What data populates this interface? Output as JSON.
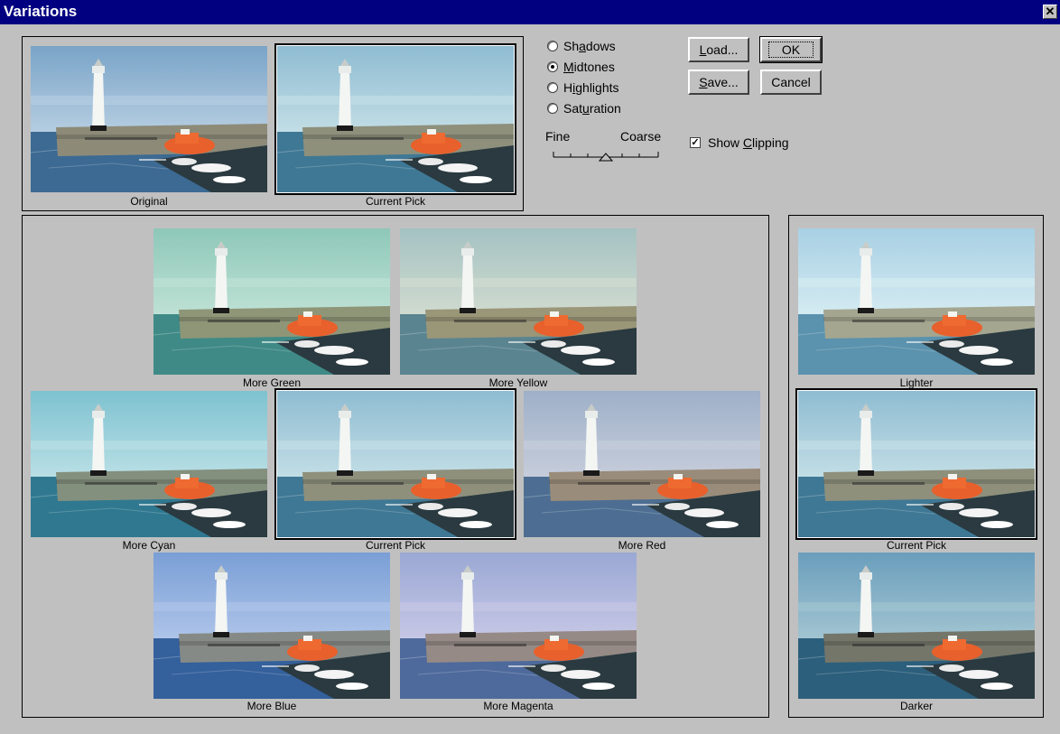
{
  "window": {
    "title": "Variations",
    "close_glyph": "✕"
  },
  "top_panel": {
    "original_caption": "Original",
    "current_pick_caption": "Current Pick"
  },
  "tone_options": [
    {
      "label": "Shadows",
      "checked": false
    },
    {
      "label": "Midtones",
      "checked": true
    },
    {
      "label": "Highlights",
      "checked": false
    },
    {
      "label": "Saturation",
      "checked": false
    }
  ],
  "slider": {
    "fine_label": "Fine",
    "coarse_label": "Coarse",
    "position_fraction": 0.5
  },
  "buttons": {
    "load_label": "Load...",
    "ok_label": "OK",
    "save_label": "Save...",
    "cancel_label": "Cancel"
  },
  "show_clipping": {
    "label": "Show Clipping",
    "checked": true
  },
  "color_variations": {
    "more_green": "More Green",
    "more_yellow": "More Yellow",
    "more_cyan": "More Cyan",
    "current_pick": "Current Pick",
    "more_red": "More Red",
    "more_blue": "More Blue",
    "more_magenta": "More Magenta"
  },
  "brightness_variations": {
    "lighter": "Lighter",
    "current_pick": "Current Pick",
    "darker": "Darker"
  },
  "tints": {
    "original": {
      "sky_top": "#7aa4c8",
      "sky_bottom": "#b8cfe2",
      "sea": "#3c6a93",
      "wall": "#8d8b78"
    },
    "current": {
      "sky_top": "#8fbcd2",
      "sky_bottom": "#c4dfe6",
      "sea": "#3f7895",
      "wall": "#8e907c"
    },
    "green": {
      "sky_top": "#8ec8b8",
      "sky_bottom": "#c0e2d6",
      "sea": "#3f8a86",
      "wall": "#8e9677"
    },
    "yellow": {
      "sky_top": "#a4c2c2",
      "sky_bottom": "#d2dcd0",
      "sea": "#5a8490",
      "wall": "#9a9678"
    },
    "cyan": {
      "sky_top": "#7ec2d0",
      "sky_bottom": "#bce0e6",
      "sea": "#2f7890",
      "wall": "#84907e"
    },
    "red": {
      "sky_top": "#9eb0c8",
      "sky_bottom": "#c8cedc",
      "sea": "#4d6e92",
      "wall": "#9a8c7a"
    },
    "blue": {
      "sky_top": "#7a9ed6",
      "sky_bottom": "#b0c6ea",
      "sea": "#34609c",
      "wall": "#868a86"
    },
    "magenta": {
      "sky_top": "#9aa8d4",
      "sky_bottom": "#c8c8e6",
      "sea": "#4e6a9c",
      "wall": "#958a86"
    },
    "lighter": {
      "sky_top": "#a8d0e4",
      "sky_bottom": "#d6ecf2",
      "sea": "#5b92ad",
      "wall": "#a4a690"
    },
    "darker": {
      "sky_top": "#6a9ebc",
      "sky_bottom": "#a4c6d2",
      "sea": "#2c5f7c",
      "wall": "#74766a"
    }
  }
}
